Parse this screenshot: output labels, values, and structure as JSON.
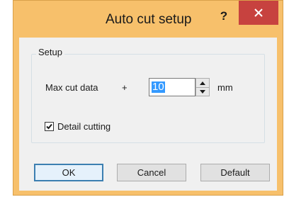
{
  "window": {
    "title": "Auto cut setup",
    "help_label": "?",
    "close_icon": "close-icon",
    "accent_color": "#f7c06b",
    "close_color": "#c7423f"
  },
  "setup_group": {
    "label": "Setup",
    "max_cut_label": "Max cut data",
    "plus_sign": "+",
    "max_cut_value": "10",
    "unit": "mm",
    "detail_cutting_label": "Detail cutting",
    "detail_cutting_checked": true
  },
  "buttons": {
    "ok": "OK",
    "cancel": "Cancel",
    "default": "Default"
  }
}
